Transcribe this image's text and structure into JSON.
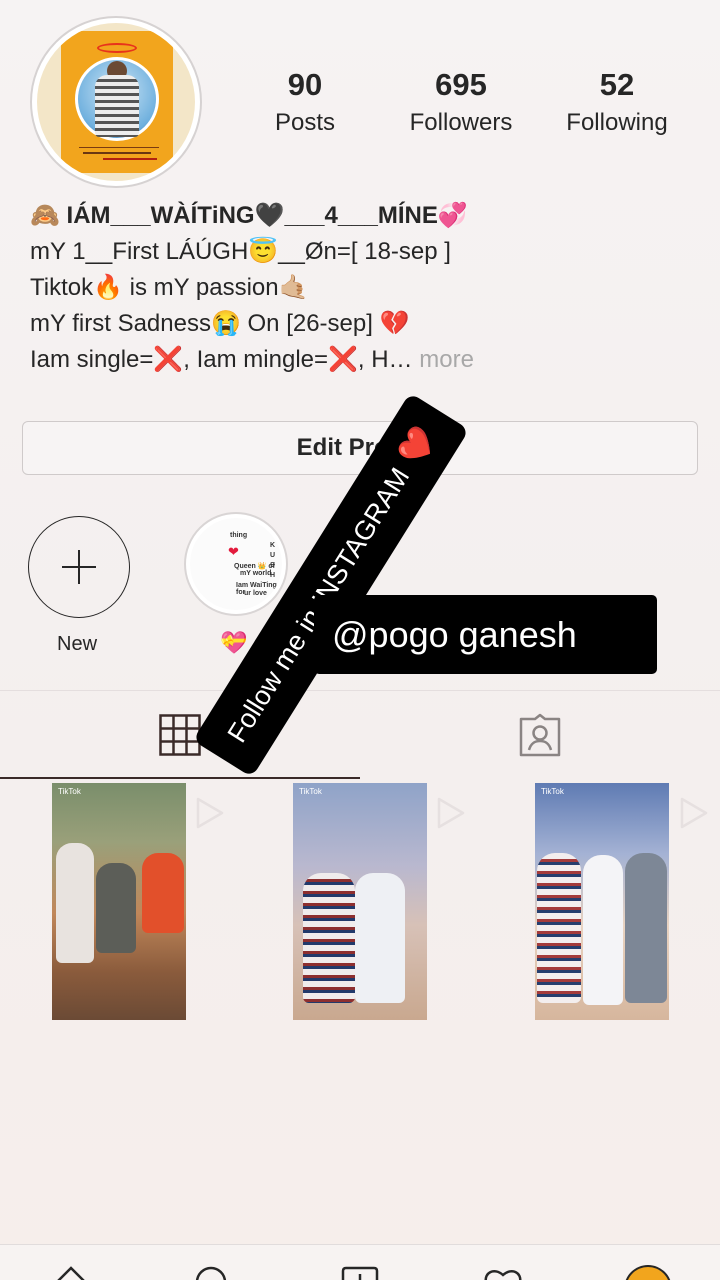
{
  "profile": {
    "stats": [
      {
        "value": "90",
        "label": "Posts"
      },
      {
        "value": "695",
        "label": "Followers"
      },
      {
        "value": "52",
        "label": "Following"
      }
    ],
    "bio": {
      "name": "🙈 ІÁМ___WÀÍТіNG🖤___4___МÍNЕ💞",
      "lines": [
        "mY 1__First LÁÚGH😇__Øn=[ 18-sep ]",
        "Tiktok🔥 is mY passion🤙🏼",
        "mY first Sadness😭 On [26-sep] 💔",
        "Iam single=❌, Iam mingle=❌, H…"
      ],
      "more": "more"
    },
    "edit_button": "Edit Profile"
  },
  "highlights": {
    "new_label": "New",
    "story_label_emoji": "💝"
  },
  "overlay": {
    "sticker_text": "Follow me in INSTAGRAM",
    "sticker_heart": "❤️",
    "handle": "@pogo ganesh"
  },
  "posts": [
    {
      "source": "TikTok"
    },
    {
      "source": "TikTok"
    },
    {
      "source": "TikTok"
    }
  ],
  "icons": {
    "grid": "grid-icon",
    "tagged": "tagged-icon",
    "home": "home-icon",
    "search": "search-icon",
    "add": "add-post-icon",
    "activity": "heart-icon",
    "profile": "profile-avatar-icon"
  },
  "colors": {
    "text": "#262626",
    "muted": "#a8a8a8",
    "accent_orange": "#f2a51d"
  }
}
